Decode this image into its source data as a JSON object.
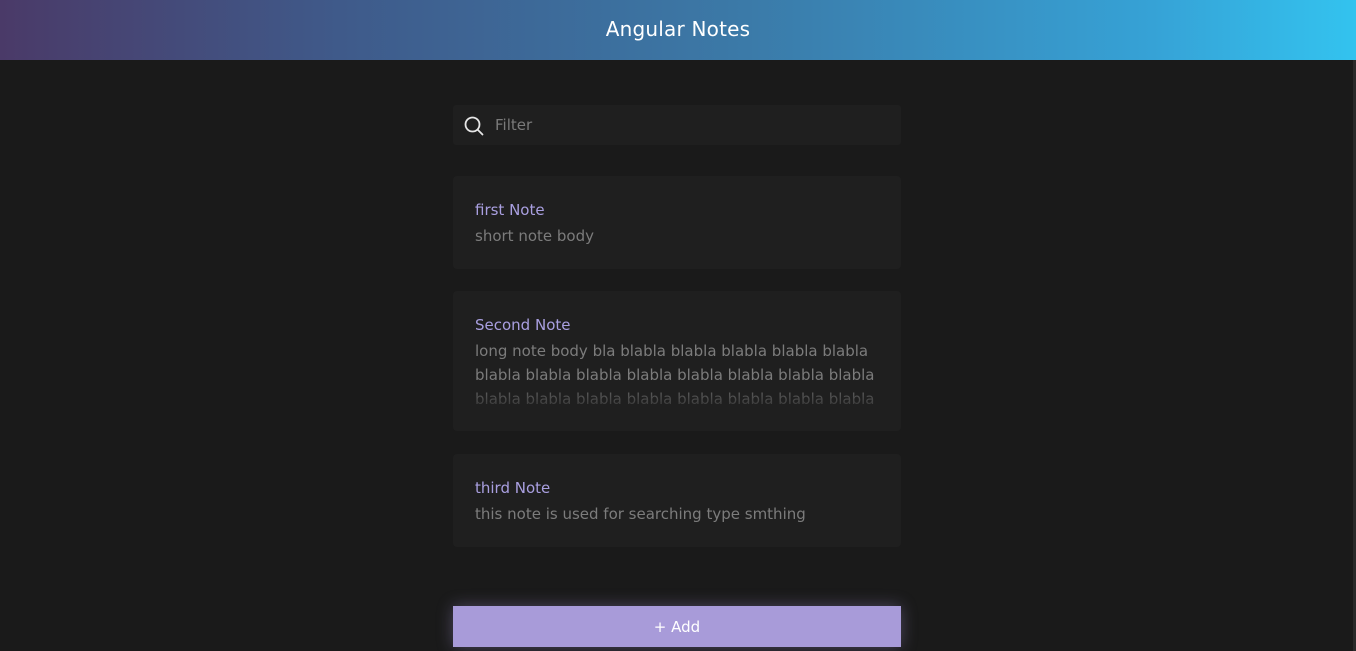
{
  "app": {
    "title": "Angular Notes"
  },
  "search": {
    "icon": "search-icon",
    "placeholder": "Filter",
    "value": ""
  },
  "notes": [
    {
      "title": "first Note",
      "body": "short note body"
    },
    {
      "title": "Second Note",
      "body": "long note body bla blabla blabla blabla blabla blabla blabla blabla blabla blabla blabla blabla blabla blabla blabla blabla blabla blabla blabla blabla blabla blabla"
    },
    {
      "title": "third Note",
      "body": "this note is used for searching type smthing"
    }
  ],
  "actions": {
    "add_label": "+ Add"
  },
  "colors": {
    "background": "#1a1a1a",
    "card": "#1f1f1f",
    "accent": "#a89bd9",
    "note_title": "#a99fe0",
    "note_body": "#7c7c7c",
    "header_gradient_start": "#4a3a68",
    "header_gradient_end": "#33c3ef"
  }
}
